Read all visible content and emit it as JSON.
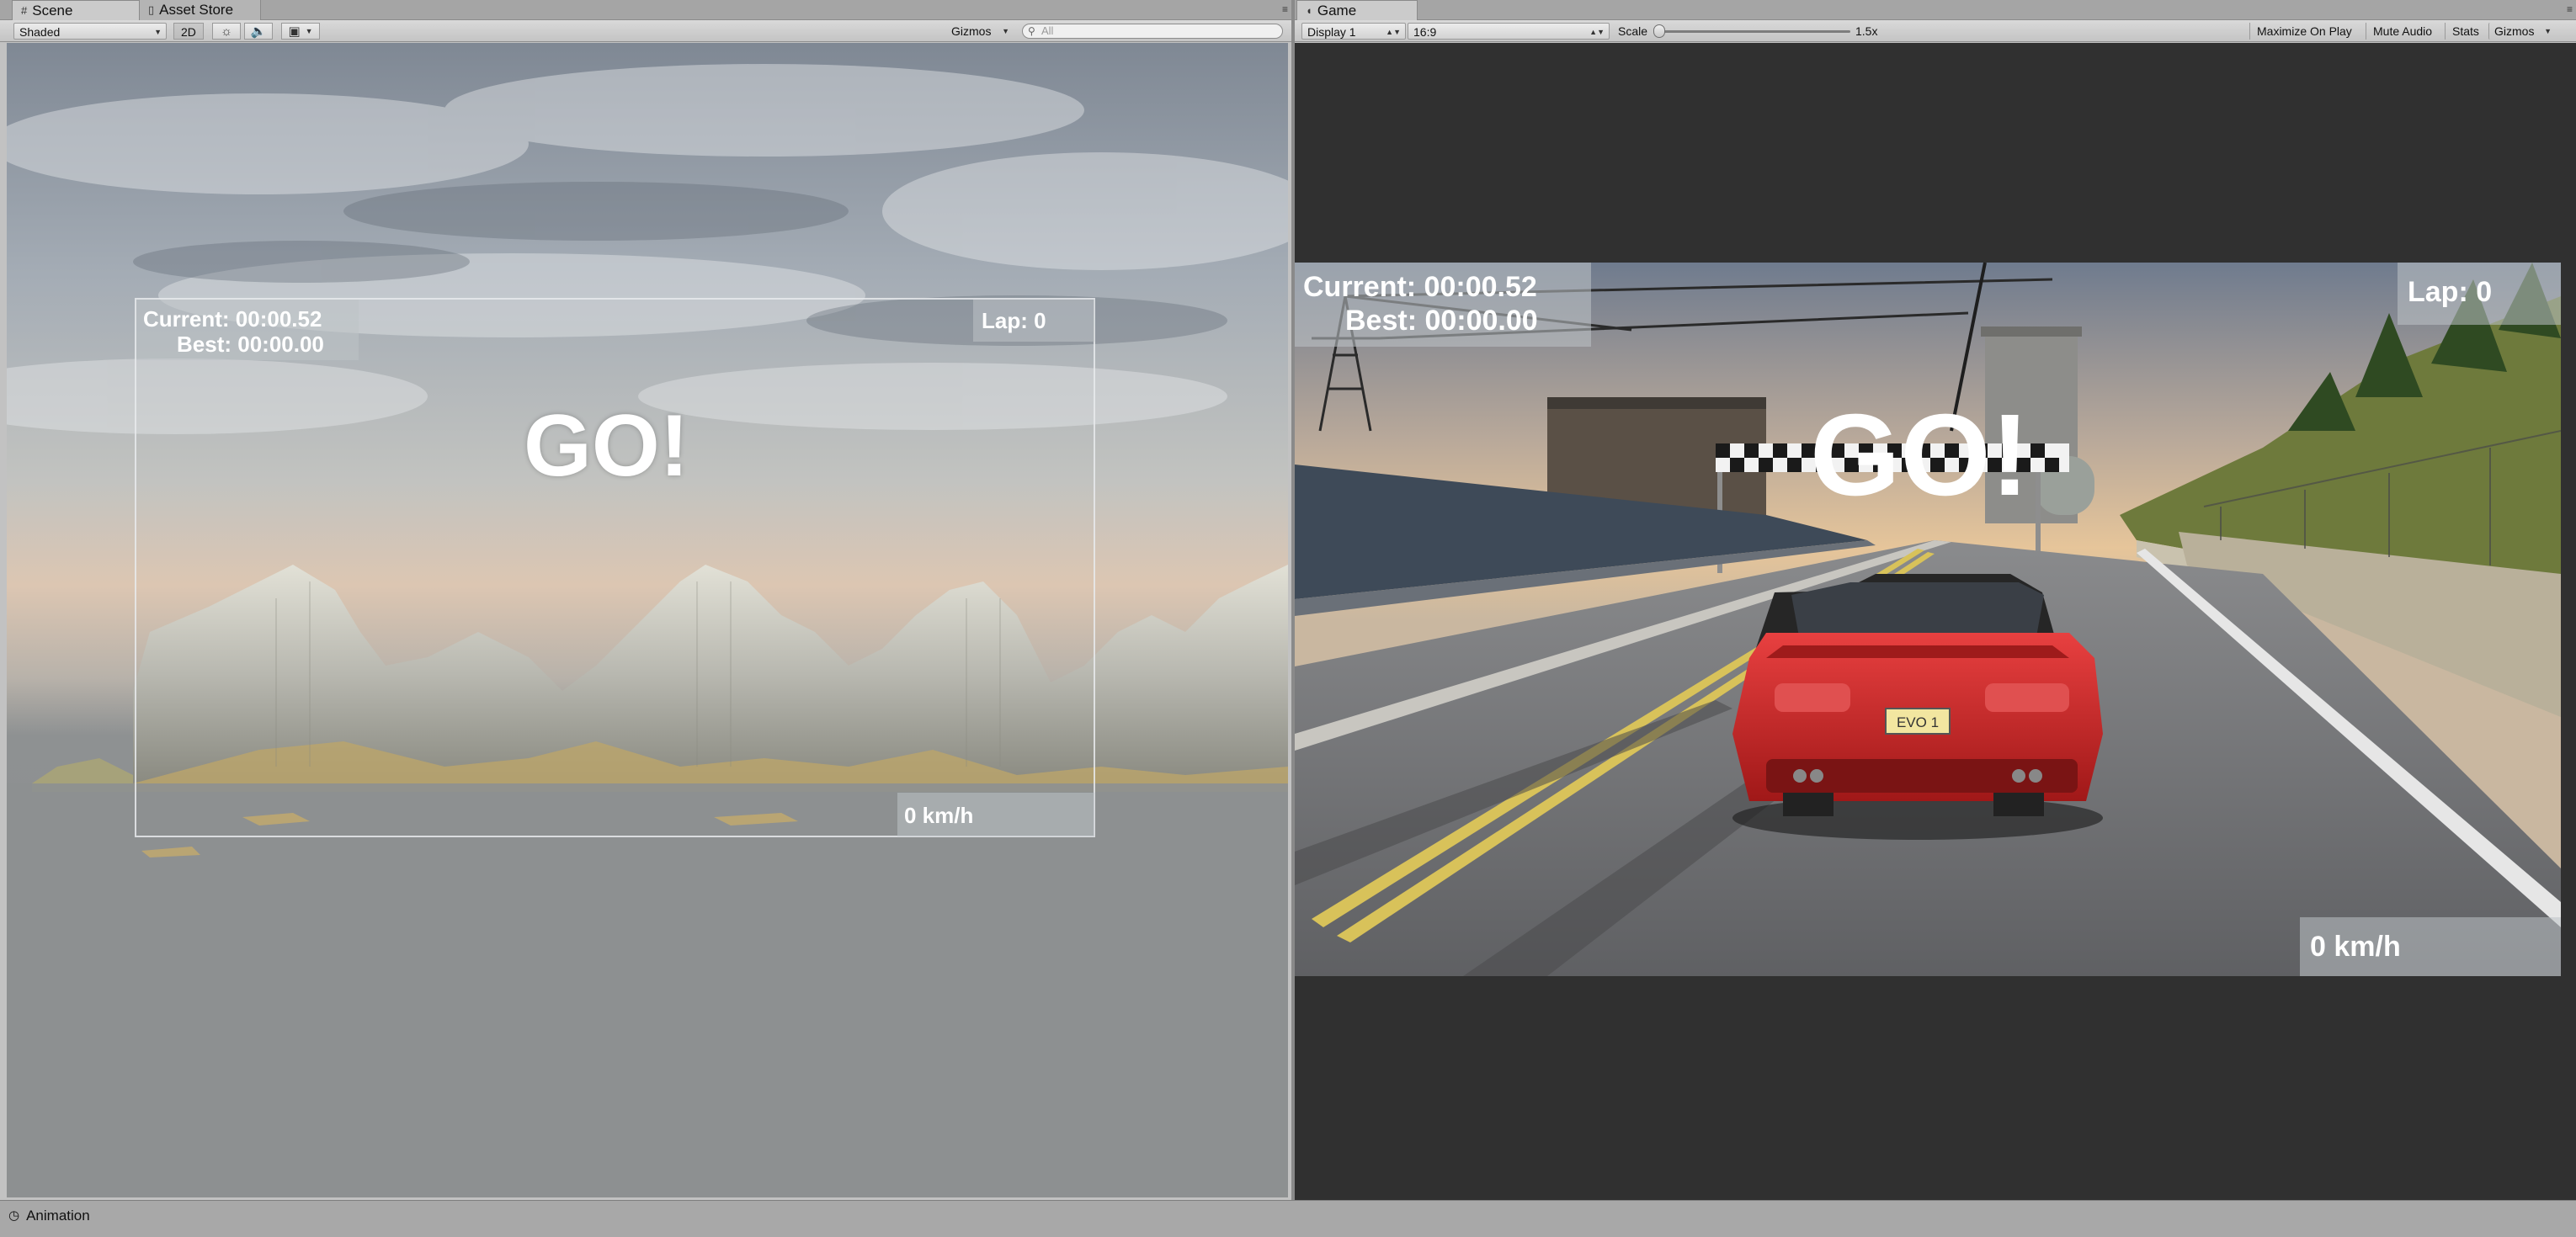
{
  "scene": {
    "tabs": [
      {
        "label": "Scene",
        "icon": "hash-icon"
      },
      {
        "label": "Asset Store",
        "icon": "shopping-bag-icon"
      }
    ],
    "toolbar": {
      "draw_mode": "Shaded",
      "mode_2d": "2D",
      "gizmos": "Gizmos",
      "search_placeholder": "All"
    },
    "hud": {
      "current": "Current: 00:00.52",
      "best": "Best: 00:00.00",
      "lap": "Lap: 0",
      "go": "GO!",
      "speed": "0 km/h"
    }
  },
  "game": {
    "tab": {
      "label": "Game",
      "icon": "pacman-icon"
    },
    "toolbar": {
      "display": "Display 1",
      "aspect": "16:9",
      "scale_label": "Scale",
      "scale_value": "1.5x",
      "scale_fraction": 0.0,
      "maximize": "Maximize On Play",
      "mute": "Mute Audio",
      "stats": "Stats",
      "gizmos": "Gizmos"
    },
    "hud": {
      "current": "Current: 00:00.52",
      "best": "Best: 00:00.00",
      "lap": "Lap: 0",
      "go": "GO!",
      "speed": "0 km/h"
    },
    "license_plate": "EVO 1"
  },
  "bottom": {
    "tab_label": "Animation"
  },
  "colors": {
    "editor_bg": "#c2c2c2",
    "game_bg": "#303030",
    "car_red": "#d42a2a"
  }
}
